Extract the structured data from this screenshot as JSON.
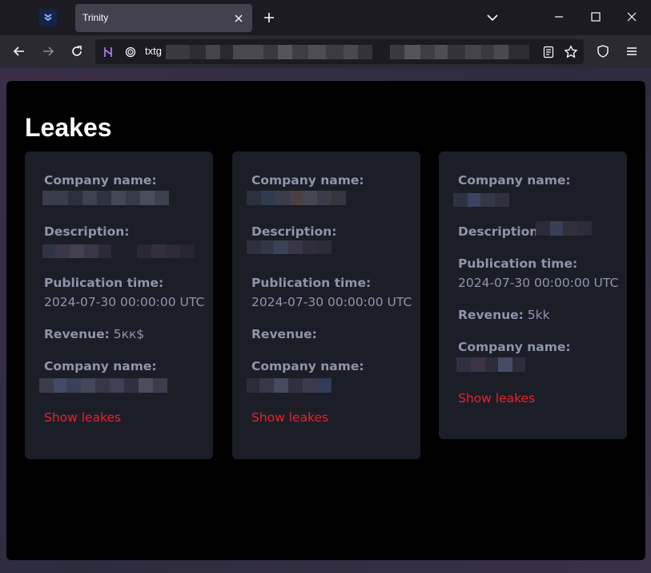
{
  "browser": {
    "tab_title": "Trinity",
    "url_visible_text": "txtg"
  },
  "page": {
    "title": "Leakes",
    "cards": [
      {
        "company_label": "Company name:",
        "description_label": "Description:",
        "publication_label": "Publication time:",
        "publication_value": "2024-07-30 00:00:00 UTC",
        "revenue_label": "Revenue:",
        "revenue_value": "5кк$",
        "company2_label": "Company name:",
        "show_link": "Show leakes"
      },
      {
        "company_label": "Company name:",
        "description_label": "Description:",
        "publication_label": "Publication time:",
        "publication_value": "2024-07-30 00:00:00 UTC",
        "revenue_label": "Revenue:",
        "revenue_value": "",
        "company2_label": "Company name:",
        "show_link": "Show leakes"
      },
      {
        "company_label": "Company name:",
        "description_label": "Description:",
        "publication_label": "Publication time:",
        "publication_value": "2024-07-30 00:00:00 UTC",
        "revenue_label": "Revenue:",
        "revenue_value": "5kk",
        "company2_label": "Company name:",
        "show_link": "Show leakes"
      }
    ]
  },
  "colors": {
    "accent_link": "#e8222e",
    "card_bg": "#1c1e27",
    "label_text": "#8e95ab",
    "page_bg": "#000000"
  },
  "icons": [
    "extension-icon",
    "close-icon",
    "plus-icon",
    "chevron-down-icon",
    "minimize-icon",
    "maximize-icon",
    "window-close-icon",
    "back-arrow-icon",
    "forward-arrow-icon",
    "reload-icon",
    "permissions-icon",
    "tracking-protection-icon",
    "reader-mode-icon",
    "star-icon",
    "shield-icon",
    "hamburger-menu-icon"
  ]
}
